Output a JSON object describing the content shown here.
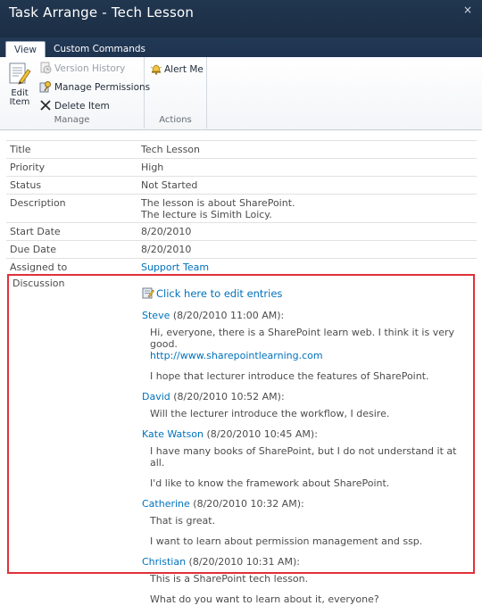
{
  "window": {
    "title": "Task Arrange - Tech Lesson",
    "close_glyph": "×"
  },
  "ribbon": {
    "tabs": [
      {
        "label": "View",
        "active": true
      },
      {
        "label": "Custom Commands",
        "active": false
      }
    ],
    "manage": {
      "edit_item": "Edit Item",
      "version_history": "Version History",
      "manage_permissions": "Manage Permissions",
      "delete_item": "Delete Item",
      "group_label": "Manage"
    },
    "actions": {
      "alert_me": "Alert Me",
      "group_label": "Actions"
    }
  },
  "fields": [
    {
      "label": "Title",
      "value": "Tech Lesson"
    },
    {
      "label": "Priority",
      "value": "High"
    },
    {
      "label": "Status",
      "value": "Not Started"
    },
    {
      "label": "Description",
      "value": "The lesson is about SharePoint.",
      "value2": "The lecture is Simith Loicy."
    },
    {
      "label": "Start Date",
      "value": "8/20/2010"
    },
    {
      "label": "Due Date",
      "value": "8/20/2010"
    },
    {
      "label": "Assigned to",
      "value": "Support Team"
    }
  ],
  "discussion": {
    "label": "Discussion",
    "edit_link": "Click here to edit entries",
    "entries": [
      {
        "author": "Steve",
        "time": "(8/20/2010 11:00 AM):",
        "lines": [
          "Hi, everyone, there is a SharePoint learn web. I think it is very good.",
          "I hope that lecturer introduce the features of SharePoint."
        ],
        "link": "http://www.sharepointlearning.com"
      },
      {
        "author": "David",
        "time": "(8/20/2010 10:52 AM):",
        "lines": [
          "Will the lecturer introduce the workflow, I desire."
        ]
      },
      {
        "author": "Kate Watson",
        "time": "(8/20/2010 10:45 AM):",
        "lines": [
          "I have many books of SharePoint, but I do not understand it at all.",
          "I'd like to know the framework about SharePoint."
        ]
      },
      {
        "author": "Catherine",
        "time": "(8/20/2010 10:32 AM):",
        "lines": [
          "That is great.",
          "I want to learn about permission management and ssp."
        ]
      },
      {
        "author": "Christian",
        "time": "(8/20/2010 10:31 AM):",
        "lines": [
          "This is a SharePoint tech lesson.",
          "What do you want to learn about it, everyone?"
        ]
      }
    ]
  },
  "colors": {
    "titlebar": "#21364f",
    "link": "#0072bc",
    "highlight_border": "#e0303a"
  }
}
